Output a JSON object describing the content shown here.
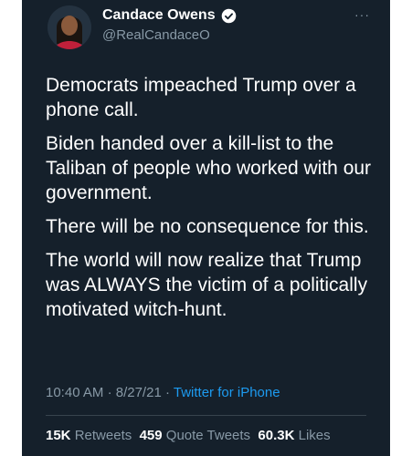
{
  "tweet": {
    "author_name": "Candace Owens",
    "handle": "@RealCandaceO",
    "more_label": "···",
    "paragraphs": [
      "Democrats impeached Trump over a phone call.",
      "Biden handed over a kill-list to the Taliban of people who worked with our government.",
      "There will be no consequence for this.",
      "The world will now realize that Trump was ALWAYS the victim of a politically motivated witch-hunt."
    ],
    "time": "10:40 AM",
    "date": "8/27/21",
    "separator": "·",
    "source": "Twitter for iPhone"
  },
  "stats": {
    "retweets_count": "15K",
    "retweets_label": "Retweets",
    "quotes_count": "459",
    "quotes_label": "Quote Tweets",
    "likes_count": "60.3K",
    "likes_label": "Likes"
  },
  "colors": {
    "background": "#15202b",
    "text": "#ffffff",
    "secondary": "#8899a6",
    "link": "#1d9bf0"
  },
  "icons": {
    "verified": "verified-badge-icon",
    "more": "more-options-icon"
  }
}
